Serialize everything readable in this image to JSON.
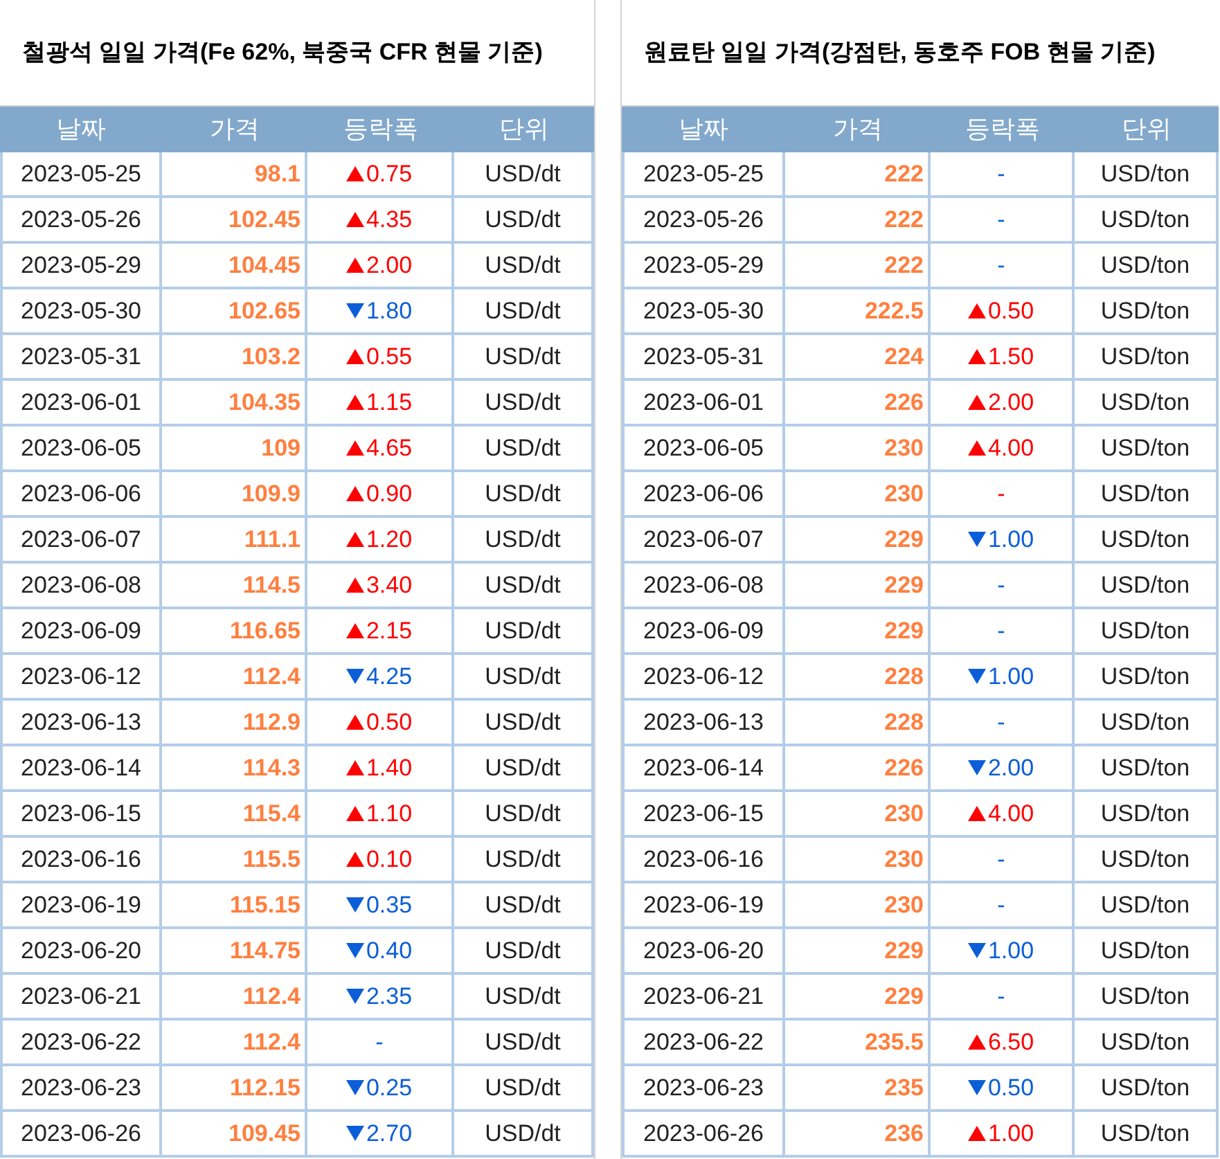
{
  "tables": [
    {
      "title": "철광석 일일 가격(Fe 62%, 북중국 CFR 현물 기준)",
      "columns": [
        "날짜",
        "가격",
        "등락폭",
        "단위"
      ],
      "rows": [
        {
          "date": "2023-05-25",
          "price": "98.1",
          "change": {
            "kind": "up",
            "text": "0.75",
            "color": "#ff0000"
          },
          "unit": "USD/dt"
        },
        {
          "date": "2023-05-26",
          "price": "102.45",
          "change": {
            "kind": "up",
            "text": "4.35",
            "color": "#ff0000"
          },
          "unit": "USD/dt"
        },
        {
          "date": "2023-05-29",
          "price": "104.45",
          "change": {
            "kind": "up",
            "text": "2.00",
            "color": "#ff0000"
          },
          "unit": "USD/dt"
        },
        {
          "date": "2023-05-30",
          "price": "102.65",
          "change": {
            "kind": "down",
            "text": "1.80",
            "color": "#0b5ed7"
          },
          "unit": "USD/dt"
        },
        {
          "date": "2023-05-31",
          "price": "103.2",
          "change": {
            "kind": "up",
            "text": "0.55",
            "color": "#ff0000"
          },
          "unit": "USD/dt"
        },
        {
          "date": "2023-06-01",
          "price": "104.35",
          "change": {
            "kind": "up",
            "text": "1.15",
            "color": "#ff0000"
          },
          "unit": "USD/dt"
        },
        {
          "date": "2023-06-05",
          "price": "109",
          "change": {
            "kind": "up",
            "text": "4.65",
            "color": "#ff0000"
          },
          "unit": "USD/dt"
        },
        {
          "date": "2023-06-06",
          "price": "109.9",
          "change": {
            "kind": "up",
            "text": "0.90",
            "color": "#ff0000"
          },
          "unit": "USD/dt"
        },
        {
          "date": "2023-06-07",
          "price": "111.1",
          "change": {
            "kind": "up",
            "text": "1.20",
            "color": "#ff0000"
          },
          "unit": "USD/dt"
        },
        {
          "date": "2023-06-08",
          "price": "114.5",
          "change": {
            "kind": "up",
            "text": "3.40",
            "color": "#ff0000"
          },
          "unit": "USD/dt"
        },
        {
          "date": "2023-06-09",
          "price": "116.65",
          "change": {
            "kind": "up",
            "text": "2.15",
            "color": "#ff0000"
          },
          "unit": "USD/dt"
        },
        {
          "date": "2023-06-12",
          "price": "112.4",
          "change": {
            "kind": "down",
            "text": "4.25",
            "color": "#0b5ed7"
          },
          "unit": "USD/dt"
        },
        {
          "date": "2023-06-13",
          "price": "112.9",
          "change": {
            "kind": "up",
            "text": "0.50",
            "color": "#ff0000"
          },
          "unit": "USD/dt"
        },
        {
          "date": "2023-06-14",
          "price": "114.3",
          "change": {
            "kind": "up",
            "text": "1.40",
            "color": "#ff0000"
          },
          "unit": "USD/dt"
        },
        {
          "date": "2023-06-15",
          "price": "115.4",
          "change": {
            "kind": "up",
            "text": "1.10",
            "color": "#ff0000"
          },
          "unit": "USD/dt"
        },
        {
          "date": "2023-06-16",
          "price": "115.5",
          "change": {
            "kind": "up",
            "text": "0.10",
            "color": "#ff0000"
          },
          "unit": "USD/dt"
        },
        {
          "date": "2023-06-19",
          "price": "115.15",
          "change": {
            "kind": "down",
            "text": "0.35",
            "color": "#0b5ed7"
          },
          "unit": "USD/dt"
        },
        {
          "date": "2023-06-20",
          "price": "114.75",
          "change": {
            "kind": "down",
            "text": "0.40",
            "color": "#0b5ed7"
          },
          "unit": "USD/dt"
        },
        {
          "date": "2023-06-21",
          "price": "112.4",
          "change": {
            "kind": "down",
            "text": "2.35",
            "color": "#0b5ed7"
          },
          "unit": "USD/dt"
        },
        {
          "date": "2023-06-22",
          "price": "112.4",
          "change": {
            "kind": "flat",
            "text": "-",
            "color": "#0b5ed7"
          },
          "unit": "USD/dt"
        },
        {
          "date": "2023-06-23",
          "price": "112.15",
          "change": {
            "kind": "down",
            "text": "0.25",
            "color": "#0b5ed7"
          },
          "unit": "USD/dt"
        },
        {
          "date": "2023-06-26",
          "price": "109.45",
          "change": {
            "kind": "down",
            "text": "2.70",
            "color": "#0b5ed7"
          },
          "unit": "USD/dt"
        }
      ]
    },
    {
      "title": "원료탄 일일 가격(강점탄, 동호주 FOB 현물 기준)",
      "columns": [
        "날짜",
        "가격",
        "등락폭",
        "단위"
      ],
      "rows": [
        {
          "date": "2023-05-25",
          "price": "222",
          "change": {
            "kind": "flat",
            "text": "-",
            "color": "#0b5ed7"
          },
          "unit": "USD/ton"
        },
        {
          "date": "2023-05-26",
          "price": "222",
          "change": {
            "kind": "flat",
            "text": "-",
            "color": "#0b5ed7"
          },
          "unit": "USD/ton"
        },
        {
          "date": "2023-05-29",
          "price": "222",
          "change": {
            "kind": "flat",
            "text": "-",
            "color": "#0b5ed7"
          },
          "unit": "USD/ton"
        },
        {
          "date": "2023-05-30",
          "price": "222.5",
          "change": {
            "kind": "up",
            "text": "0.50",
            "color": "#ff0000"
          },
          "unit": "USD/ton"
        },
        {
          "date": "2023-05-31",
          "price": "224",
          "change": {
            "kind": "up",
            "text": "1.50",
            "color": "#ff0000"
          },
          "unit": "USD/ton"
        },
        {
          "date": "2023-06-01",
          "price": "226",
          "change": {
            "kind": "up",
            "text": "2.00",
            "color": "#ff0000"
          },
          "unit": "USD/ton"
        },
        {
          "date": "2023-06-05",
          "price": "230",
          "change": {
            "kind": "up",
            "text": "4.00",
            "color": "#ff0000"
          },
          "unit": "USD/ton"
        },
        {
          "date": "2023-06-06",
          "price": "230",
          "change": {
            "kind": "flat",
            "text": "-",
            "color": "#ff0000"
          },
          "unit": "USD/ton"
        },
        {
          "date": "2023-06-07",
          "price": "229",
          "change": {
            "kind": "down",
            "text": "1.00",
            "color": "#0b5ed7"
          },
          "unit": "USD/ton"
        },
        {
          "date": "2023-06-08",
          "price": "229",
          "change": {
            "kind": "flat",
            "text": "-",
            "color": "#0b5ed7"
          },
          "unit": "USD/ton"
        },
        {
          "date": "2023-06-09",
          "price": "229",
          "change": {
            "kind": "flat",
            "text": "-",
            "color": "#0b5ed7"
          },
          "unit": "USD/ton"
        },
        {
          "date": "2023-06-12",
          "price": "228",
          "change": {
            "kind": "down",
            "text": "1.00",
            "color": "#0b5ed7"
          },
          "unit": "USD/ton"
        },
        {
          "date": "2023-06-13",
          "price": "228",
          "change": {
            "kind": "flat",
            "text": "-",
            "color": "#0b5ed7"
          },
          "unit": "USD/ton"
        },
        {
          "date": "2023-06-14",
          "price": "226",
          "change": {
            "kind": "down",
            "text": "2.00",
            "color": "#0b5ed7"
          },
          "unit": "USD/ton"
        },
        {
          "date": "2023-06-15",
          "price": "230",
          "change": {
            "kind": "up",
            "text": "4.00",
            "color": "#ff0000"
          },
          "unit": "USD/ton"
        },
        {
          "date": "2023-06-16",
          "price": "230",
          "change": {
            "kind": "flat",
            "text": "-",
            "color": "#0b5ed7"
          },
          "unit": "USD/ton"
        },
        {
          "date": "2023-06-19",
          "price": "230",
          "change": {
            "kind": "flat",
            "text": "-",
            "color": "#0b5ed7"
          },
          "unit": "USD/ton"
        },
        {
          "date": "2023-06-20",
          "price": "229",
          "change": {
            "kind": "down",
            "text": "1.00",
            "color": "#0b5ed7"
          },
          "unit": "USD/ton"
        },
        {
          "date": "2023-06-21",
          "price": "229",
          "change": {
            "kind": "flat",
            "text": "-",
            "color": "#0b5ed7"
          },
          "unit": "USD/ton"
        },
        {
          "date": "2023-06-22",
          "price": "235.5",
          "change": {
            "kind": "up",
            "text": "6.50",
            "color": "#ff0000"
          },
          "unit": "USD/ton"
        },
        {
          "date": "2023-06-23",
          "price": "235",
          "change": {
            "kind": "down",
            "text": "0.50",
            "color": "#0b5ed7"
          },
          "unit": "USD/ton"
        },
        {
          "date": "2023-06-26",
          "price": "236",
          "change": {
            "kind": "up",
            "text": "1.00",
            "color": "#ff0000"
          },
          "unit": "USD/ton"
        }
      ]
    }
  ]
}
